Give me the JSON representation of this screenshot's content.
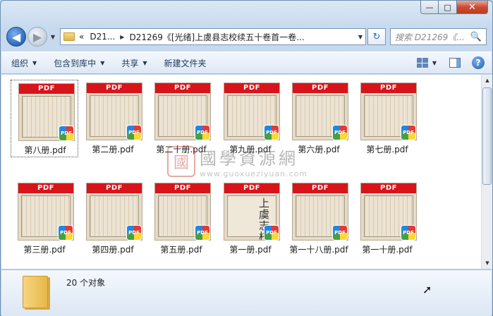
{
  "window": {
    "controls": {
      "minimize": "—",
      "maximize": "□",
      "close": "✕"
    }
  },
  "nav": {
    "back_glyph": "◀",
    "forward_glyph": "▶",
    "address": {
      "overflow": "«",
      "crumb1": "D21...",
      "crumb2": "D21269《[光绪]上虞县志校续五十卷首一卷...",
      "separator": "▶"
    },
    "refresh_glyph": "↻",
    "search_placeholder": "搜索 D21269《...",
    "search_icon": "🔍"
  },
  "toolbar": {
    "organize": "组织",
    "include_library": "包含到库中",
    "share": "共享",
    "new_folder": "新建文件夹",
    "help": "?"
  },
  "files": [
    {
      "name": "第八册.pdf",
      "badge": "PDF"
    },
    {
      "name": "第二册.pdf",
      "badge": "PDF"
    },
    {
      "name": "第二十册.pdf",
      "badge": "PDF"
    },
    {
      "name": "第九册.pdf",
      "badge": "PDF"
    },
    {
      "name": "第六册.pdf",
      "badge": "PDF"
    },
    {
      "name": "第七册.pdf",
      "badge": "PDF"
    },
    {
      "name": "第三册.pdf",
      "badge": "PDF"
    },
    {
      "name": "第四册.pdf",
      "badge": "PDF"
    },
    {
      "name": "第五册.pdf",
      "badge": "PDF"
    },
    {
      "name": "第一册.pdf",
      "badge": "PDF",
      "glyphs": "上虞志校續"
    },
    {
      "name": "第一十八册.pdf",
      "badge": "PDF"
    },
    {
      "name": "第一十册.pdf",
      "badge": "PDF"
    }
  ],
  "watermark": {
    "seal": "國",
    "cn": "國學資源網",
    "url": "www.guoxueziyuan.com"
  },
  "status": {
    "count": "20 个对象"
  }
}
